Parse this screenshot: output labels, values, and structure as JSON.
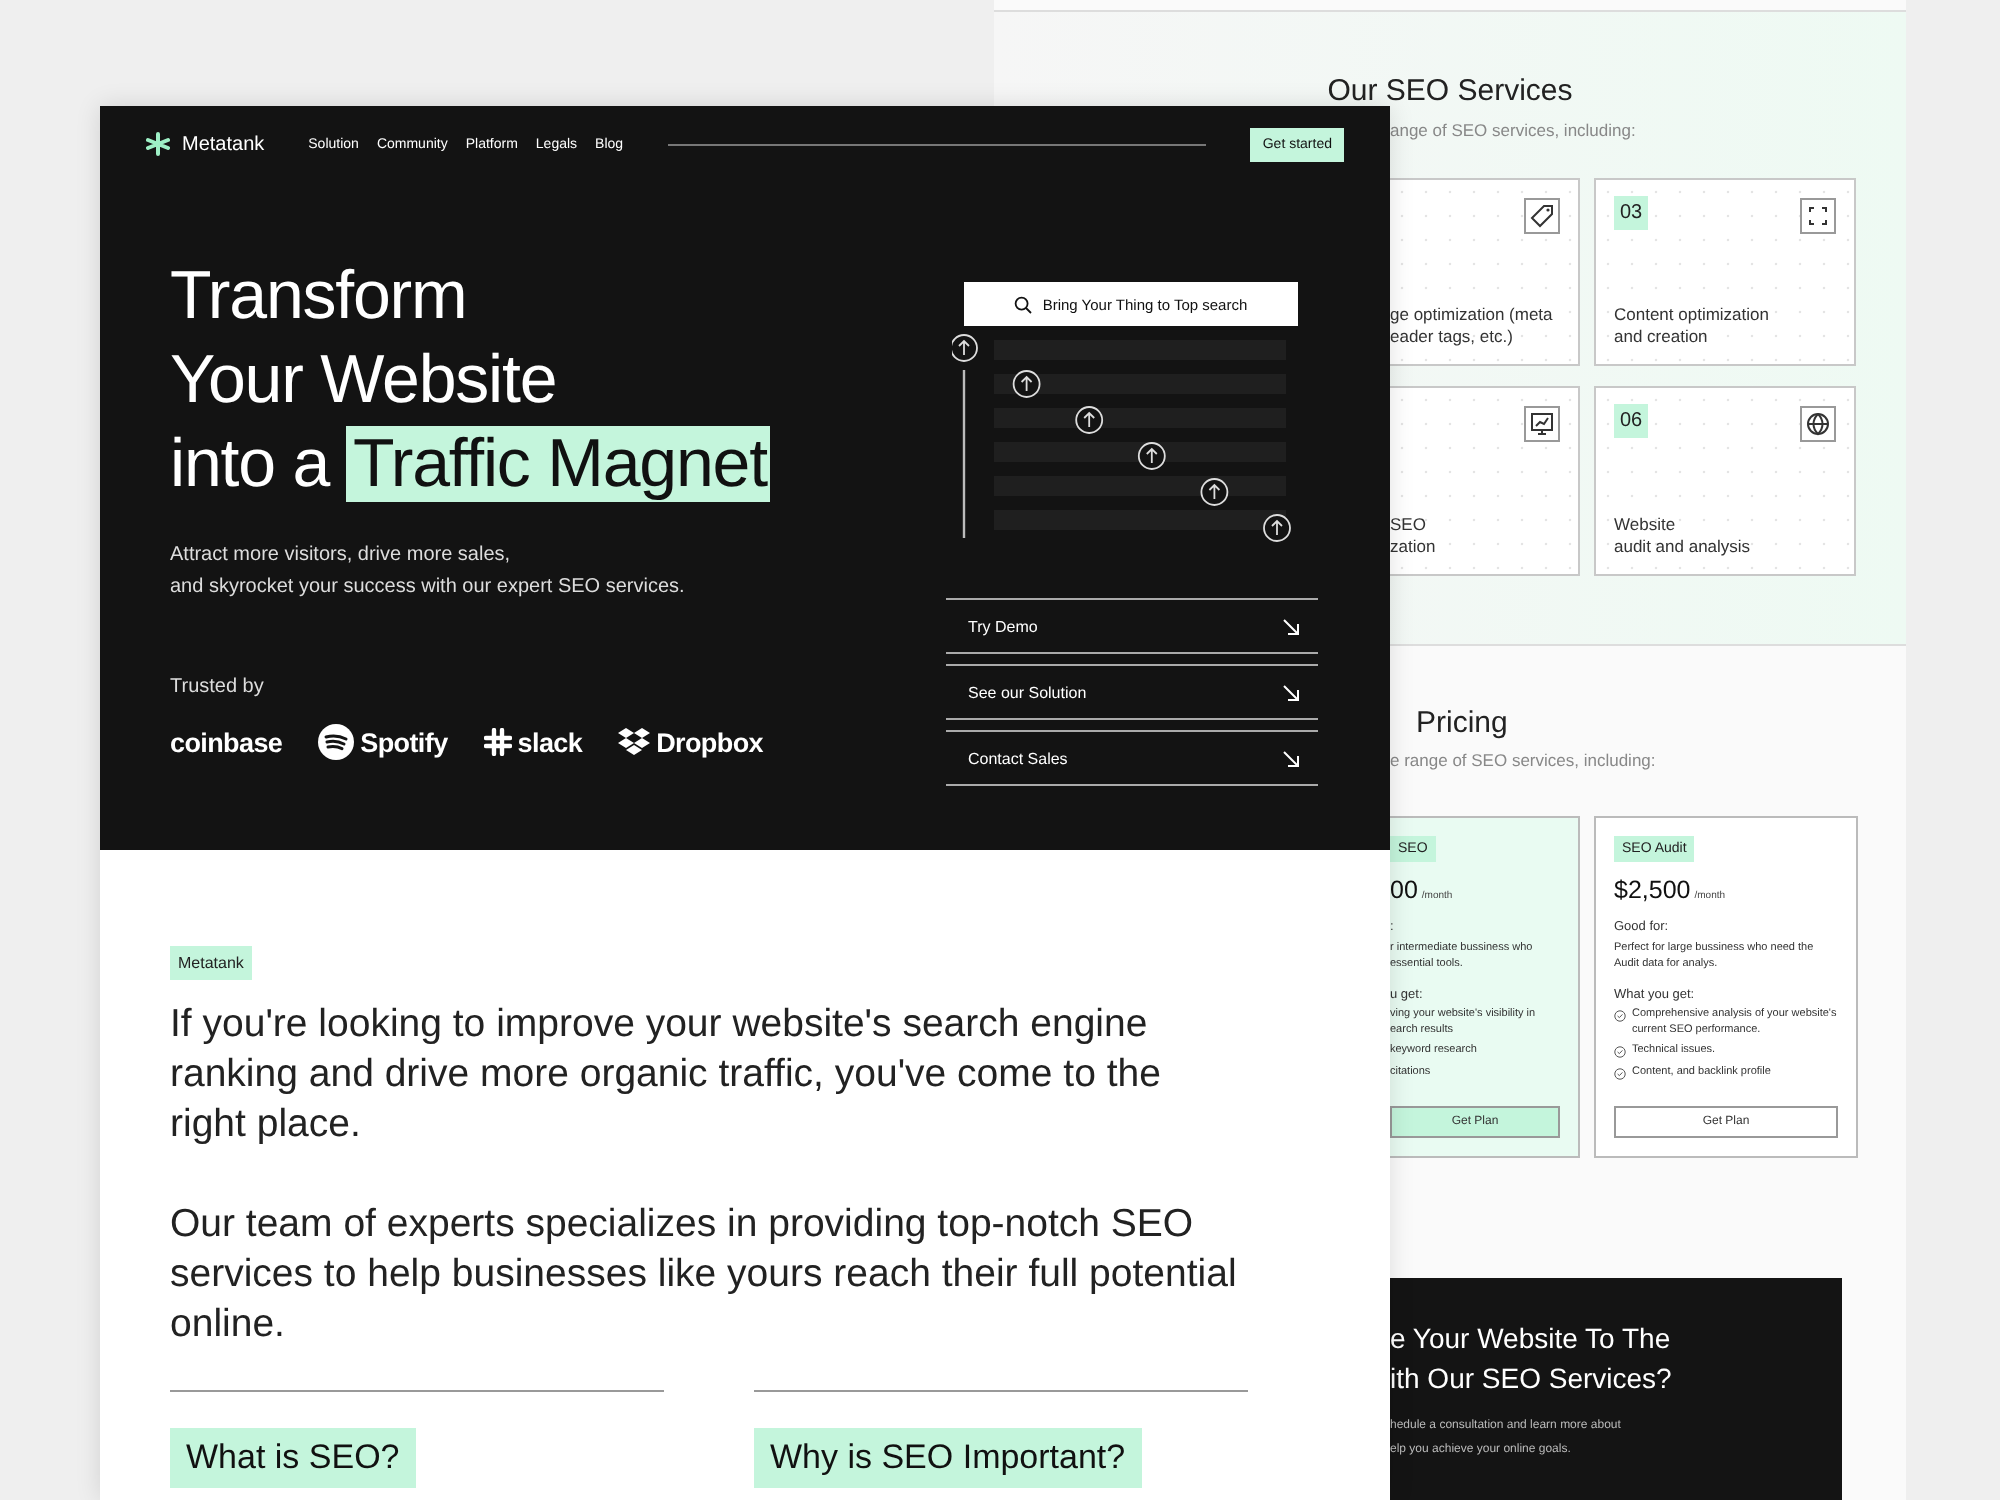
{
  "back_page": {
    "services": {
      "title": "Our SEO Services",
      "subtitle": "ange of SEO services, including:",
      "cards": [
        {
          "lines": [
            "ge optimization (meta",
            "eader tags, etc.)"
          ]
        },
        {
          "number": "03",
          "lines": [
            "Content optimization",
            "and creation"
          ]
        },
        {
          "lines": [
            "SEO",
            "zation"
          ]
        },
        {
          "number": "06",
          "lines": [
            "Website",
            "audit and analysis"
          ]
        }
      ]
    },
    "pricing": {
      "title": "Pricing",
      "subtitle": "e range of SEO services, including:",
      "plans": [
        {
          "highlighted": true,
          "badge": "SEO",
          "price": "00",
          "period": "/month",
          "good_for_label": ":",
          "good_for": "r intermediate bussiness who essential tools.",
          "get_label": "u get:",
          "items": [
            "ving your website's visibility in earch results",
            "keyword research",
            "citations"
          ],
          "show_checks": false,
          "button": "Get Plan"
        },
        {
          "highlighted": false,
          "badge": "SEO Audit",
          "price": "$2,500",
          "period": "/month",
          "good_for_label": "Good for:",
          "good_for": "Perfect for large bussiness who need the Audit data for analys.",
          "get_label": "What you get:",
          "items": [
            "Comprehensive analysis of your website's current SEO performance.",
            "Technical issues.",
            "Content, and backlink profile"
          ],
          "show_checks": true,
          "button": "Get Plan"
        }
      ]
    },
    "cta": {
      "title_lines": [
        "e Your Website To The",
        "ith Our SEO Services?"
      ],
      "text_lines": [
        "hedule a consultation and learn more about",
        "elp you achieve your online goals."
      ]
    }
  },
  "front_page": {
    "nav": {
      "brand": "Metatank",
      "links": [
        "Solution",
        "Community",
        "Platform",
        "Legals",
        "Blog"
      ],
      "button": "Get started"
    },
    "hero": {
      "title_lines": [
        "Transform",
        "Your Website"
      ],
      "title_prefix": "into a",
      "title_highlight": "Traffic Magnet",
      "subtitle_lines": [
        "Attract more visitors, drive more sales,",
        "and skyrocket your success with our expert SEO services."
      ],
      "trusted_label": "Trusted by",
      "logos": [
        "coinbase",
        "Spotify",
        "slack",
        "Dropbox"
      ],
      "search": "Bring Your Thing to Top search",
      "links": [
        "Try Demo",
        "See our Solution",
        "Contact Sales"
      ]
    },
    "intro": {
      "badge": "Metatank",
      "paragraphs": [
        "If you're looking to improve your website's search engine ranking and drive more organic traffic, you've come to the right place.",
        "Our team of experts specializes in providing top-notch SEO services to help businesses like yours reach their full potential online."
      ],
      "topics": [
        "What is SEO?",
        "Why is SEO Important?"
      ]
    }
  }
}
